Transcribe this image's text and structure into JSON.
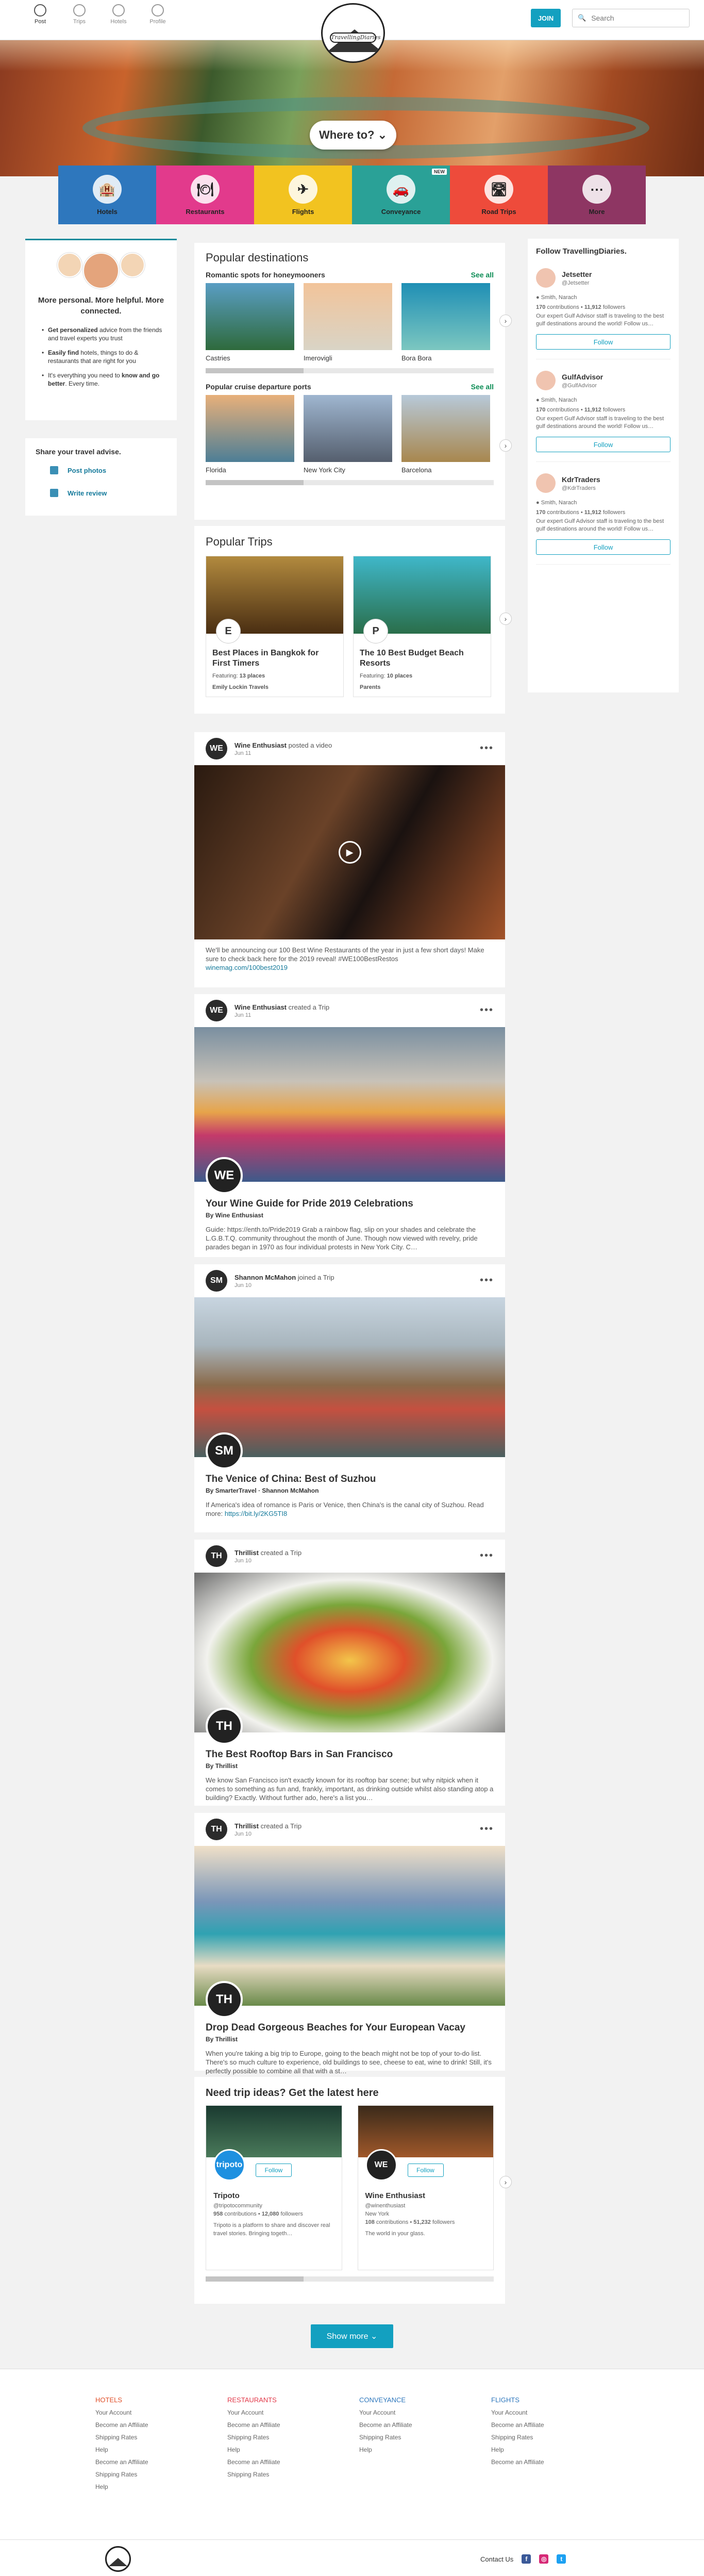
{
  "topnav": [
    {
      "label": "Post",
      "active": true
    },
    {
      "label": "Trips"
    },
    {
      "label": "Hotels"
    },
    {
      "label": "Profile"
    }
  ],
  "logo": {
    "text": "TravellingDiaries"
  },
  "header": {
    "join": "JOIN",
    "search_placeholder": "Search"
  },
  "hero": {
    "cta": "Where to?"
  },
  "categories": [
    {
      "label": "Hotels",
      "color": "#2e77bd",
      "icon": "🏨"
    },
    {
      "label": "Restaurants",
      "color": "#e23a8c",
      "icon": "🍽"
    },
    {
      "label": "Flights",
      "color": "#f2c320",
      "icon": "✈"
    },
    {
      "label": "Conveyance",
      "color": "#2aa197",
      "icon": "🚗",
      "badge": "NEW"
    },
    {
      "label": "Road Trips",
      "color": "#ee4b3b",
      "icon": "🛣"
    },
    {
      "label": "More",
      "color": "#8e3663",
      "icon": "⋯"
    }
  ],
  "left": {
    "title": "More personal. More helpful. More connected.",
    "bullets": [
      {
        "b": "Get personalized",
        "t": " advice from the friends and travel experts you trust"
      },
      {
        "b": "Easily find",
        "t": " hotels, things to do & restaurants that are right for you"
      },
      {
        "b": "",
        "t": "It's everything you need to ",
        "b2": "know and go better",
        "t2": ". Every time."
      }
    ],
    "share_title": "Share your travel advise.",
    "share_actions": [
      "Post photos",
      "Write review"
    ]
  },
  "popular": {
    "title": "Popular destinations",
    "see_all": "See all",
    "sections": [
      {
        "title": "Romantic spots for honeymooners",
        "items": [
          {
            "name": "Castries",
            "c1": "#5a9ec4",
            "c2": "#2e6a3c"
          },
          {
            "name": "Imerovigli",
            "c1": "#f2c49a",
            "c2": "#d9d4c6"
          },
          {
            "name": "Bora Bora",
            "c1": "#1f8fb5",
            "c2": "#7cc7c0"
          }
        ]
      },
      {
        "title": "Popular cruise departure ports",
        "items": [
          {
            "name": "Florida",
            "c1": "#e8b07a",
            "c2": "#4d7e96"
          },
          {
            "name": "New York City",
            "c1": "#9fb6d0",
            "c2": "#555f6e"
          },
          {
            "name": "Barcelona",
            "c1": "#b7c9d9",
            "c2": "#a8874e"
          }
        ]
      }
    ]
  },
  "trips": {
    "title": "Popular Trips",
    "items": [
      {
        "title": "Best Places in Bangkok for First Timers",
        "featuring": "Featuring: ",
        "places": "13 places",
        "author": "Emily Lockin Travels",
        "c1": "#b28a3e",
        "c2": "#4a2e12",
        "badge": "E"
      },
      {
        "title": "The 10 Best Budget Beach Resorts",
        "featuring": "Featuring: ",
        "places": "10 places",
        "author": "Parents",
        "c1": "#3fb7c9",
        "c2": "#2a6e4a",
        "badge": "P"
      }
    ]
  },
  "follow": {
    "title": "Follow TravellingDiaries.",
    "button": "Follow",
    "users": [
      {
        "name": "Jetsetter",
        "handle": "@Jetsetter",
        "loc": "Smith, Narach",
        "contrib": "170",
        "followers": "11,912",
        "desc": "Our expert Gulf Advisor staff is traveling to the best gulf destinations around the world! Follow us…"
      },
      {
        "name": "GulfAdvisor",
        "handle": "@GulfAdvisor",
        "loc": "Smith, Narach",
        "contrib": "170",
        "followers": "11,912",
        "desc": "Our expert Gulf Advisor staff is traveling to the best gulf destinations around the world! Follow us…"
      },
      {
        "name": "KdrTraders",
        "handle": "@KdrTraders",
        "loc": "Smith, Narach",
        "contrib": "170",
        "followers": "11,912",
        "desc": "Our expert Gulf Advisor staff is traveling to the best gulf destinations around the world! Follow us…"
      }
    ]
  },
  "posts": [
    {
      "author": "Wine Enthusiast",
      "action": " posted a video",
      "date": "Jun 11",
      "av": "WE",
      "text": "We'll be announcing our 100 Best Wine Restaurants of the year in just a few short days! Make sure to check back here for the 2019 reveal! #WE100BestRestos",
      "link": "winemag.com/100best2019",
      "video": true
    },
    {
      "author": "Wine Enthusiast",
      "action": " created a Trip",
      "date": "Jun 11",
      "av": "WE",
      "title": "Your Wine Guide for Pride 2019 Celebrations",
      "by": "By ",
      "byname": "Wine Enthusiast",
      "text": "Guide: https://enth.to/Pride2019 Grab a rainbow flag, slip on your shades and celebrate the L.G.B.T.Q. community throughout the month of June. Though now viewed with revelry, pride parades began in 1970 as four individual protests in New York City. C…"
    },
    {
      "author": "Shannon McMahon",
      "action": " joined a Trip",
      "date": "Jun 10",
      "av": "SM",
      "title": "The Venice of China: Best of Suzhou",
      "by": "By ",
      "byname": "SmarterTravel",
      "byname2": "Shannon McMahon",
      "text": "If America's idea of romance is Paris or Venice, then China's is the canal city of Suzhou. Read more: ",
      "link": "https://bit.ly/2KG5TI8"
    },
    {
      "author": "Thrillist",
      "action": " created a Trip",
      "date": "Jun 10",
      "av": "TH",
      "title": "The Best Rooftop Bars in San Francisco",
      "by": "By ",
      "byname": "Thrillist",
      "text": "We know San Francisco isn't exactly known for its rooftop bar scene; but why nitpick when it comes to something as fun and, frankly, important, as drinking outside whilst also standing atop a building? Exactly. Without further ado, here's a list you…"
    },
    {
      "author": "Thrillist",
      "action": " created a Trip",
      "date": "Jun 10",
      "av": "TH",
      "title": "Drop Dead Gorgeous Beaches for Your European Vacay",
      "by": "By ",
      "byname": "Thrillist",
      "text": "When you're taking a big trip to Europe, going to the beach might not be top of your to-do list. There's so much culture to experience, old buildings to see, cheese to eat, wine to drink! Still, it's perfectly possible to combine all that with a st…"
    }
  ],
  "ntp": {
    "title": "Need trip ideas? Get the latest here",
    "profiles": [
      {
        "name": "Tripoto",
        "handle": "@tripotocommunity",
        "contrib": "958",
        "followers": "12,080",
        "desc": "Tripoto is a platform to share and discover real travel stories. Bringing togeth…",
        "av": "tripoto",
        "color": "#1e90e0"
      },
      {
        "name": "Wine Enthusiast",
        "handle": "@winenthusiast",
        "loc": "New York",
        "contrib": "108",
        "followers": "51,232",
        "desc": "The world in your glass.",
        "av": "WE",
        "color": "#222"
      }
    ],
    "follow": "Follow"
  },
  "show_more": "Show more",
  "footer": {
    "cols": [
      {
        "title": "HOTELS",
        "links": [
          "Your Account",
          "Become an Affiliate",
          "Shipping Rates",
          "Help",
          "Become an Affiliate",
          "Shipping Rates",
          "Help"
        ]
      },
      {
        "title": "RESTAURANTS",
        "links": [
          "Your Account",
          "Become an Affiliate",
          "Shipping Rates",
          "Help",
          "Become an Affiliate",
          "Shipping Rates"
        ]
      },
      {
        "title": "CONVEYANCE",
        "links": [
          "Your Account",
          "Become an Affiliate",
          "Shipping Rates",
          "Help"
        ]
      },
      {
        "title": "FLIGHTS",
        "links": [
          "Your Account",
          "Become an Affiliate",
          "Shipping Rates",
          "Help",
          "Become an Affiliate"
        ]
      }
    ],
    "contact": "Contact Us"
  }
}
